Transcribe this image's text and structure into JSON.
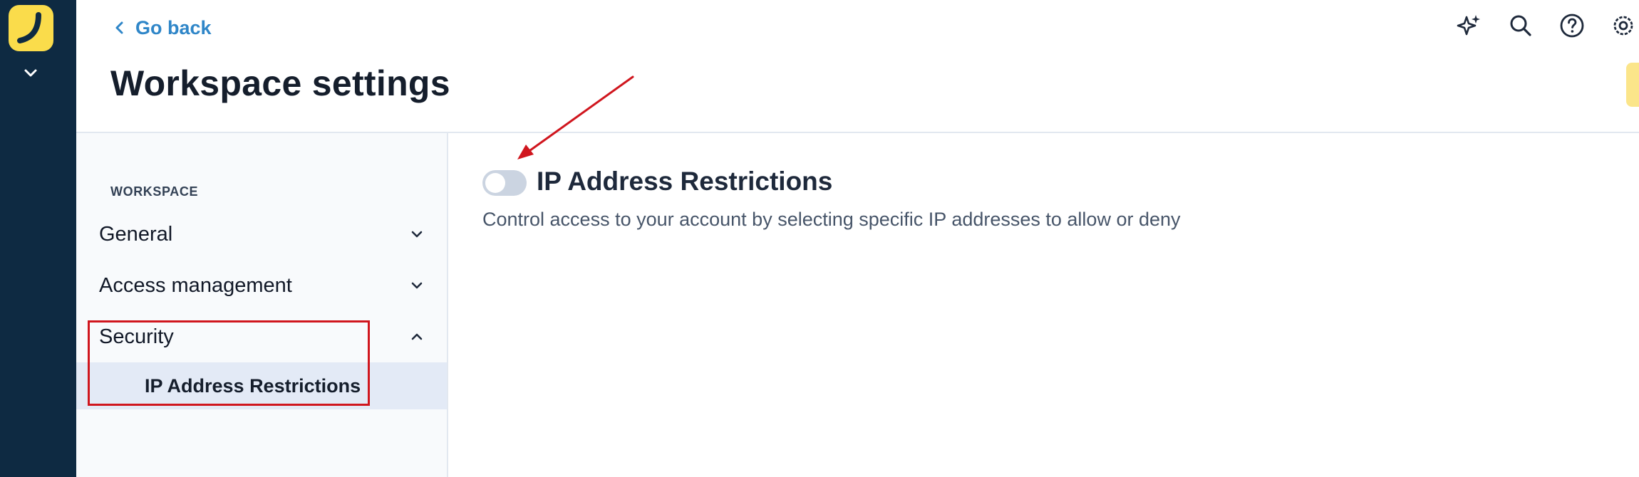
{
  "nav": {
    "back_label": "Go back"
  },
  "page": {
    "title": "Workspace settings"
  },
  "top_icons": [
    "sparkle-icon",
    "search-icon",
    "help-icon",
    "gear-icon"
  ],
  "sidebar": {
    "section_label": "WORKSPACE",
    "items": [
      {
        "label": "General",
        "expanded": false
      },
      {
        "label": "Access management",
        "expanded": false
      },
      {
        "label": "Security",
        "expanded": true
      }
    ],
    "sub_item": {
      "label": "IP Address Restrictions",
      "selected": true
    }
  },
  "content": {
    "toggle_on": false,
    "title": "IP Address Restrictions",
    "description": "Control access to your account by selecting specific IP addresses to allow or deny"
  },
  "colors": {
    "rail": "#0e2a42",
    "logo": "#fadc4b",
    "link": "#2f86c8",
    "annotation": "#d0161e",
    "selected_bg": "#e3eaf6"
  }
}
